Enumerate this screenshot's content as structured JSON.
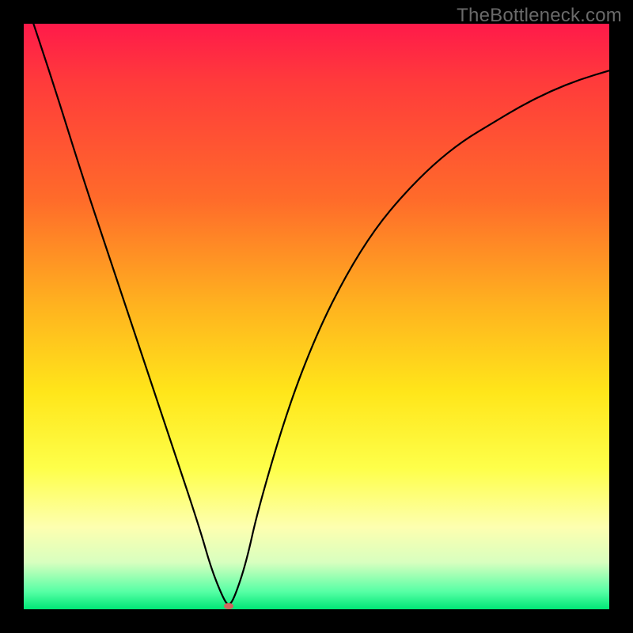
{
  "watermark": "TheBottleneck.com",
  "chart_data": {
    "type": "line",
    "title": "",
    "xlabel": "",
    "ylabel": "",
    "xlim": [
      0,
      100
    ],
    "ylim": [
      0,
      100
    ],
    "series": [
      {
        "name": "curve",
        "x": [
          0,
          5,
          10,
          15,
          20,
          25,
          30,
          32,
          34,
          35,
          36,
          38,
          40,
          45,
          50,
          55,
          60,
          65,
          70,
          75,
          80,
          85,
          90,
          95,
          100
        ],
        "y": [
          105,
          90,
          74,
          59,
          44,
          29,
          14,
          7,
          2,
          0.5,
          2,
          8,
          17,
          34,
          47,
          57,
          65,
          71,
          76,
          80,
          83,
          86,
          88.5,
          90.5,
          92
        ]
      }
    ],
    "marker": {
      "x": 35,
      "y": 0.5
    }
  },
  "colors": {
    "curve": "#000000",
    "marker": "#d1665f"
  }
}
